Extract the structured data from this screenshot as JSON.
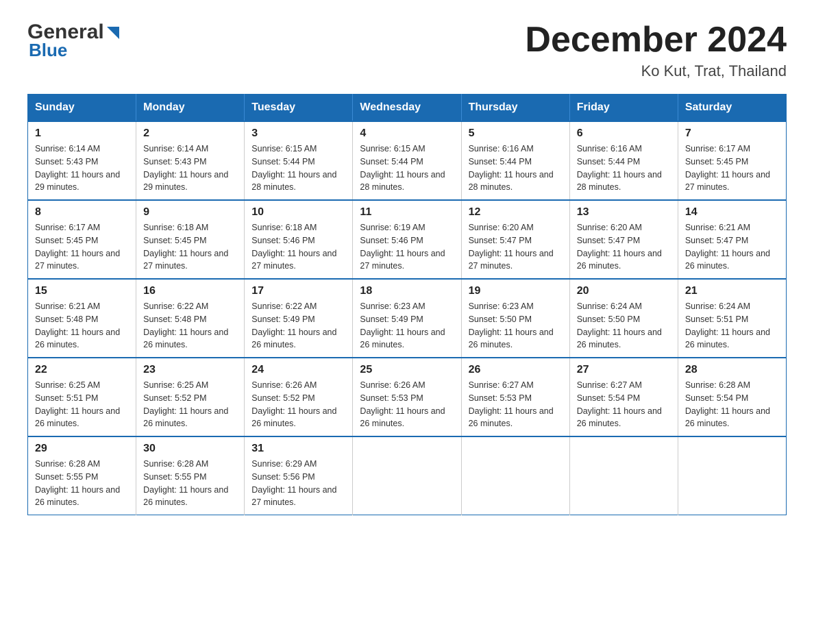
{
  "header": {
    "logo_general": "General",
    "logo_blue": "Blue",
    "month_title": "December 2024",
    "location": "Ko Kut, Trat, Thailand"
  },
  "days_of_week": [
    "Sunday",
    "Monday",
    "Tuesday",
    "Wednesday",
    "Thursday",
    "Friday",
    "Saturday"
  ],
  "weeks": [
    [
      {
        "day": "1",
        "sunrise": "6:14 AM",
        "sunset": "5:43 PM",
        "daylight": "11 hours and 29 minutes."
      },
      {
        "day": "2",
        "sunrise": "6:14 AM",
        "sunset": "5:43 PM",
        "daylight": "11 hours and 29 minutes."
      },
      {
        "day": "3",
        "sunrise": "6:15 AM",
        "sunset": "5:44 PM",
        "daylight": "11 hours and 28 minutes."
      },
      {
        "day": "4",
        "sunrise": "6:15 AM",
        "sunset": "5:44 PM",
        "daylight": "11 hours and 28 minutes."
      },
      {
        "day": "5",
        "sunrise": "6:16 AM",
        "sunset": "5:44 PM",
        "daylight": "11 hours and 28 minutes."
      },
      {
        "day": "6",
        "sunrise": "6:16 AM",
        "sunset": "5:44 PM",
        "daylight": "11 hours and 28 minutes."
      },
      {
        "day": "7",
        "sunrise": "6:17 AM",
        "sunset": "5:45 PM",
        "daylight": "11 hours and 27 minutes."
      }
    ],
    [
      {
        "day": "8",
        "sunrise": "6:17 AM",
        "sunset": "5:45 PM",
        "daylight": "11 hours and 27 minutes."
      },
      {
        "day": "9",
        "sunrise": "6:18 AM",
        "sunset": "5:45 PM",
        "daylight": "11 hours and 27 minutes."
      },
      {
        "day": "10",
        "sunrise": "6:18 AM",
        "sunset": "5:46 PM",
        "daylight": "11 hours and 27 minutes."
      },
      {
        "day": "11",
        "sunrise": "6:19 AM",
        "sunset": "5:46 PM",
        "daylight": "11 hours and 27 minutes."
      },
      {
        "day": "12",
        "sunrise": "6:20 AM",
        "sunset": "5:47 PM",
        "daylight": "11 hours and 27 minutes."
      },
      {
        "day": "13",
        "sunrise": "6:20 AM",
        "sunset": "5:47 PM",
        "daylight": "11 hours and 26 minutes."
      },
      {
        "day": "14",
        "sunrise": "6:21 AM",
        "sunset": "5:47 PM",
        "daylight": "11 hours and 26 minutes."
      }
    ],
    [
      {
        "day": "15",
        "sunrise": "6:21 AM",
        "sunset": "5:48 PM",
        "daylight": "11 hours and 26 minutes."
      },
      {
        "day": "16",
        "sunrise": "6:22 AM",
        "sunset": "5:48 PM",
        "daylight": "11 hours and 26 minutes."
      },
      {
        "day": "17",
        "sunrise": "6:22 AM",
        "sunset": "5:49 PM",
        "daylight": "11 hours and 26 minutes."
      },
      {
        "day": "18",
        "sunrise": "6:23 AM",
        "sunset": "5:49 PM",
        "daylight": "11 hours and 26 minutes."
      },
      {
        "day": "19",
        "sunrise": "6:23 AM",
        "sunset": "5:50 PM",
        "daylight": "11 hours and 26 minutes."
      },
      {
        "day": "20",
        "sunrise": "6:24 AM",
        "sunset": "5:50 PM",
        "daylight": "11 hours and 26 minutes."
      },
      {
        "day": "21",
        "sunrise": "6:24 AM",
        "sunset": "5:51 PM",
        "daylight": "11 hours and 26 minutes."
      }
    ],
    [
      {
        "day": "22",
        "sunrise": "6:25 AM",
        "sunset": "5:51 PM",
        "daylight": "11 hours and 26 minutes."
      },
      {
        "day": "23",
        "sunrise": "6:25 AM",
        "sunset": "5:52 PM",
        "daylight": "11 hours and 26 minutes."
      },
      {
        "day": "24",
        "sunrise": "6:26 AM",
        "sunset": "5:52 PM",
        "daylight": "11 hours and 26 minutes."
      },
      {
        "day": "25",
        "sunrise": "6:26 AM",
        "sunset": "5:53 PM",
        "daylight": "11 hours and 26 minutes."
      },
      {
        "day": "26",
        "sunrise": "6:27 AM",
        "sunset": "5:53 PM",
        "daylight": "11 hours and 26 minutes."
      },
      {
        "day": "27",
        "sunrise": "6:27 AM",
        "sunset": "5:54 PM",
        "daylight": "11 hours and 26 minutes."
      },
      {
        "day": "28",
        "sunrise": "6:28 AM",
        "sunset": "5:54 PM",
        "daylight": "11 hours and 26 minutes."
      }
    ],
    [
      {
        "day": "29",
        "sunrise": "6:28 AM",
        "sunset": "5:55 PM",
        "daylight": "11 hours and 26 minutes."
      },
      {
        "day": "30",
        "sunrise": "6:28 AM",
        "sunset": "5:55 PM",
        "daylight": "11 hours and 26 minutes."
      },
      {
        "day": "31",
        "sunrise": "6:29 AM",
        "sunset": "5:56 PM",
        "daylight": "11 hours and 27 minutes."
      },
      {
        "day": "",
        "sunrise": "",
        "sunset": "",
        "daylight": ""
      },
      {
        "day": "",
        "sunrise": "",
        "sunset": "",
        "daylight": ""
      },
      {
        "day": "",
        "sunrise": "",
        "sunset": "",
        "daylight": ""
      },
      {
        "day": "",
        "sunrise": "",
        "sunset": "",
        "daylight": ""
      }
    ]
  ]
}
